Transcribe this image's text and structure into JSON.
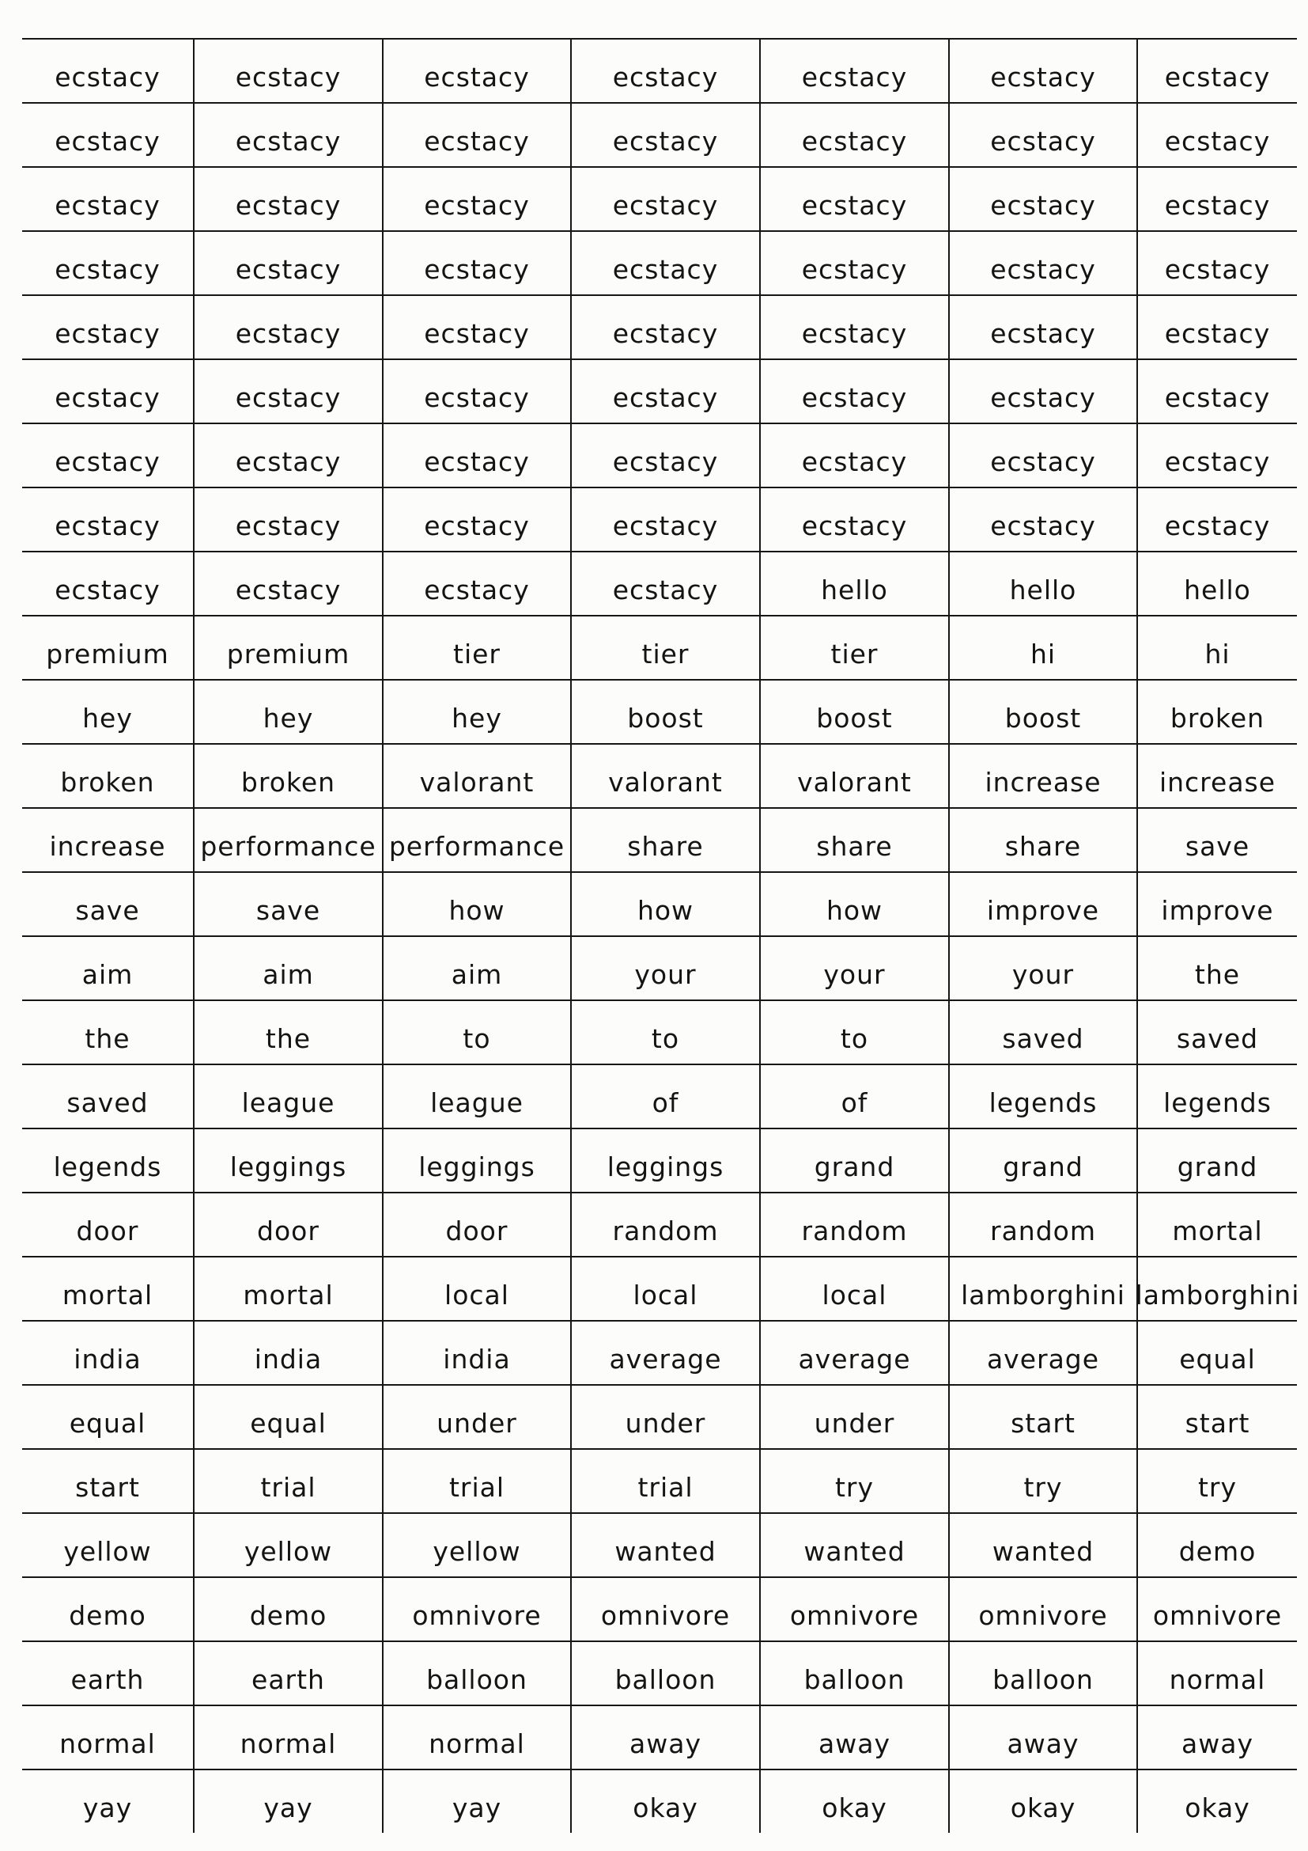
{
  "rows": [
    [
      "ecstacy",
      "ecstacy",
      "ecstacy",
      "ecstacy",
      "ecstacy",
      "ecstacy",
      "ecstacy"
    ],
    [
      "ecstacy",
      "ecstacy",
      "ecstacy",
      "ecstacy",
      "ecstacy",
      "ecstacy",
      "ecstacy"
    ],
    [
      "ecstacy",
      "ecstacy",
      "ecstacy",
      "ecstacy",
      "ecstacy",
      "ecstacy",
      "ecstacy"
    ],
    [
      "ecstacy",
      "ecstacy",
      "ecstacy",
      "ecstacy",
      "ecstacy",
      "ecstacy",
      "ecstacy"
    ],
    [
      "ecstacy",
      "ecstacy",
      "ecstacy",
      "ecstacy",
      "ecstacy",
      "ecstacy",
      "ecstacy"
    ],
    [
      "ecstacy",
      "ecstacy",
      "ecstacy",
      "ecstacy",
      "ecstacy",
      "ecstacy",
      "ecstacy"
    ],
    [
      "ecstacy",
      "ecstacy",
      "ecstacy",
      "ecstacy",
      "ecstacy",
      "ecstacy",
      "ecstacy"
    ],
    [
      "ecstacy",
      "ecstacy",
      "ecstacy",
      "ecstacy",
      "ecstacy",
      "ecstacy",
      "ecstacy"
    ],
    [
      "ecstacy",
      "ecstacy",
      "ecstacy",
      "ecstacy",
      "hello",
      "hello",
      "hello"
    ],
    [
      "premium",
      "premium",
      "tier",
      "tier",
      "tier",
      "hi",
      "hi"
    ],
    [
      "hey",
      "hey",
      "hey",
      "boost",
      "boost",
      "boost",
      "broken"
    ],
    [
      "broken",
      "broken",
      "valorant",
      "valorant",
      "valorant",
      "increase",
      "increase"
    ],
    [
      "increase",
      "performance",
      "performance",
      "share",
      "share",
      "share",
      "save"
    ],
    [
      "save",
      "save",
      "how",
      "how",
      "how",
      "improve",
      "improve"
    ],
    [
      "aim",
      "aim",
      "aim",
      "your",
      "your",
      "your",
      "the"
    ],
    [
      "the",
      "the",
      "to",
      "to",
      "to",
      "saved",
      "saved"
    ],
    [
      "saved",
      "league",
      "league",
      "of",
      "of",
      "legends",
      "legends"
    ],
    [
      "legends",
      "leggings",
      "leggings",
      "leggings",
      "grand",
      "grand",
      "grand"
    ],
    [
      "door",
      "door",
      "door",
      "random",
      "random",
      "random",
      "mortal"
    ],
    [
      "mortal",
      "mortal",
      "local",
      "local",
      "local",
      "lamborghini",
      "lamborghini"
    ],
    [
      "india",
      "india",
      "india",
      "average",
      "average",
      "average",
      "equal"
    ],
    [
      "equal",
      "equal",
      "under",
      "under",
      "under",
      "start",
      "start"
    ],
    [
      "start",
      "trial",
      "trial",
      "trial",
      "try",
      "try",
      "try"
    ],
    [
      "yellow",
      "yellow",
      "yellow",
      "wanted",
      "wanted",
      "wanted",
      "demo"
    ],
    [
      "demo",
      "demo",
      "omnivore",
      "omnivore",
      "omnivore",
      "omnivore",
      "omnivore"
    ],
    [
      "earth",
      "earth",
      "balloon",
      "balloon",
      "balloon",
      "balloon",
      "normal"
    ],
    [
      "normal",
      "normal",
      "normal",
      "away",
      "away",
      "away",
      "away"
    ],
    [
      "yay",
      "yay",
      "yay",
      "okay",
      "okay",
      "okay",
      "okay"
    ]
  ]
}
